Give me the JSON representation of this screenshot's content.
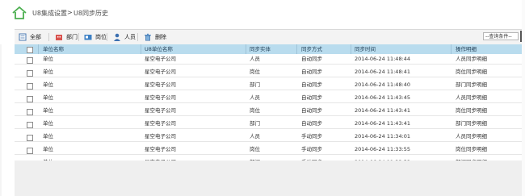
{
  "breadcrumb": {
    "parent": "U8集成设置",
    "separator": ">",
    "current": "U8同步历史"
  },
  "toolbar": {
    "buttons": [
      {
        "label": "全部",
        "icon": "list-icon"
      },
      {
        "label": "部门",
        "icon": "department-icon"
      },
      {
        "label": "岗位",
        "icon": "position-icon"
      },
      {
        "label": "人员",
        "icon": "person-icon"
      },
      {
        "label": "删除",
        "icon": "delete-icon"
      }
    ],
    "query_placeholder": "--查询条件--"
  },
  "table": {
    "headers": [
      "单位名称",
      "U8单位名称",
      "同步实体",
      "同步方式",
      "同步时间",
      "操作明细"
    ],
    "rows": [
      [
        "单位",
        "星空电子公司",
        "人员",
        "自动同步",
        "2014-06-24 11:48:44",
        "人员同步明细"
      ],
      [
        "单位",
        "星空电子公司",
        "岗位",
        "自动同步",
        "2014-06-24 11:48:41",
        "岗位同步明细"
      ],
      [
        "单位",
        "星空电子公司",
        "部门",
        "自动同步",
        "2014-06-24 11:48:40",
        "部门同步明细"
      ],
      [
        "单位",
        "星空电子公司",
        "人员",
        "自动同步",
        "2014-06-24 11:43:45",
        "人员同步明细"
      ],
      [
        "单位",
        "星空电子公司",
        "岗位",
        "自动同步",
        "2014-06-24 11:43:41",
        "岗位同步明细"
      ],
      [
        "单位",
        "星空电子公司",
        "部门",
        "自动同步",
        "2014-06-24 11:43:41",
        "部门同步明细"
      ],
      [
        "单位",
        "星空电子公司",
        "人员",
        "手动同步",
        "2014-06-24 11:34:01",
        "人员同步明细"
      ],
      [
        "单位",
        "星空电子公司",
        "岗位",
        "手动同步",
        "2014-06-24 11:33:55",
        "岗位同步明细"
      ],
      [
        "单位",
        "星空电子公司",
        "部门",
        "手动同步",
        "2014-06-24 11:33:53",
        "部门同步明细"
      ]
    ]
  },
  "colors": {
    "header_bg": "#b9dcee",
    "home_icon": "#4caf50",
    "bottom_area": "#efefef"
  }
}
